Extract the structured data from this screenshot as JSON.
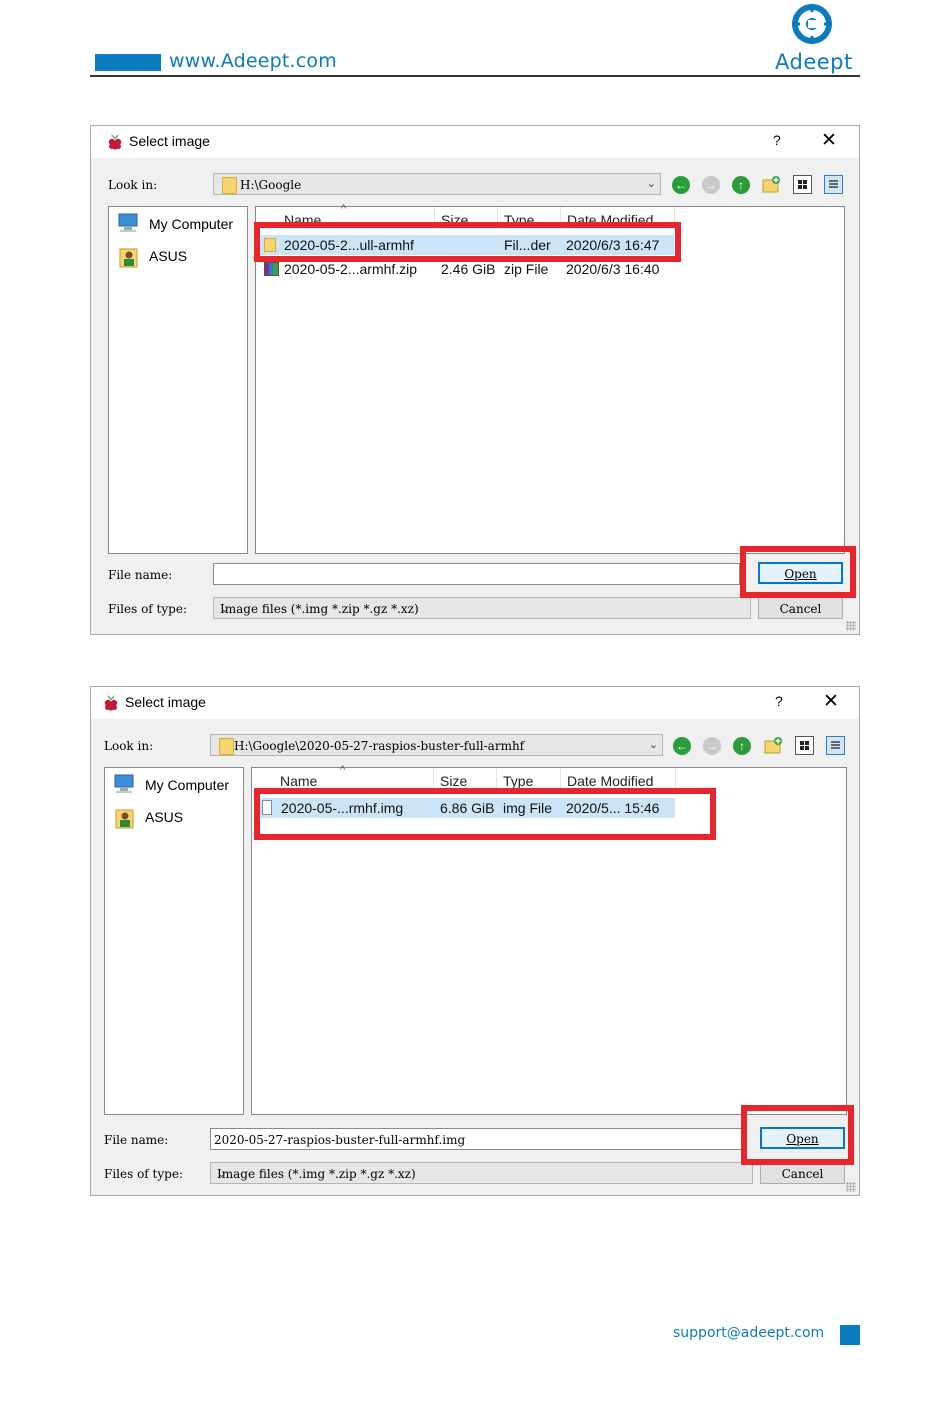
{
  "header": {
    "website": "www.Adeept.com",
    "brand": "Adeept"
  },
  "footer": {
    "support_email": "support@adeept.com"
  },
  "dialogs": [
    {
      "title": "Select image",
      "help": "?",
      "close": "✕",
      "look_in_label": "Look in:",
      "look_in_value": "H:\\Google",
      "sidebar": [
        "My Computer",
        "ASUS"
      ],
      "columns": [
        "Name",
        "Size",
        "Type",
        "Date Modified"
      ],
      "rows": [
        {
          "name": "2020-05-2...ull-armhf",
          "size": "",
          "type": "Fil...der",
          "date": "2020/6/3 16:47",
          "icon": "folder-icon",
          "selected": true
        },
        {
          "name": "2020-05-2...armhf.zip",
          "size": "2.46 GiB",
          "type": "zip File",
          "date": "2020/6/3 16:40",
          "icon": "zip-archive-icon",
          "selected": false
        }
      ],
      "file_name_label": "File name:",
      "file_name_value": "",
      "files_of_type_label": "Files of type:",
      "files_of_type_value": "Image files (*.img *.zip *.gz *.xz)",
      "open_label": "Open",
      "cancel_label": "Cancel"
    },
    {
      "title": "Select image",
      "help": "?",
      "close": "✕",
      "look_in_label": "Look in:",
      "look_in_value": "H:\\Google\\2020-05-27-raspios-buster-full-armhf",
      "sidebar": [
        "My Computer",
        "ASUS"
      ],
      "columns": [
        "Name",
        "Size",
        "Type",
        "Date Modified"
      ],
      "rows": [
        {
          "name": "2020-05-...rmhf.img",
          "size": "6.86 GiB",
          "type": "img File",
          "date": "2020/5... 15:46",
          "icon": "image-file-icon",
          "selected": true
        }
      ],
      "file_name_label": "File name:",
      "file_name_value": "2020-05-27-raspios-buster-full-armhf.img",
      "files_of_type_label": "Files of type:",
      "files_of_type_value": "Image files (*.img *.zip *.gz *.xz)",
      "open_label": "Open",
      "cancel_label": "Cancel"
    }
  ],
  "colors": {
    "brand_blue": "#0b7bbf",
    "highlight_red": "#e8242c",
    "selection": "#cce4f7"
  }
}
